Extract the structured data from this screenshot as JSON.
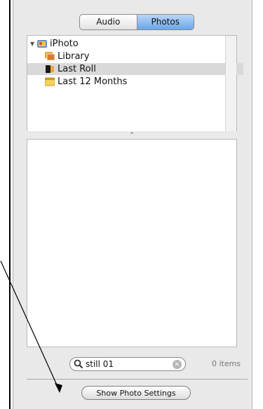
{
  "tabs": {
    "audio": "Audio",
    "photos": "Photos",
    "selected": "Photos"
  },
  "sources": {
    "root": "iPhoto",
    "items": [
      {
        "label": "Library"
      },
      {
        "label": "Last Roll",
        "selected": true
      },
      {
        "label": "Last 12 Months"
      }
    ]
  },
  "splitter": "⌃",
  "search": {
    "value": "still 01"
  },
  "status": {
    "count": "0 items"
  },
  "footer": {
    "settings_button": "Show Photo Settings"
  },
  "colors": {
    "selected_tab": "#6aa6ea",
    "selected_row": "#d9d9d9"
  }
}
